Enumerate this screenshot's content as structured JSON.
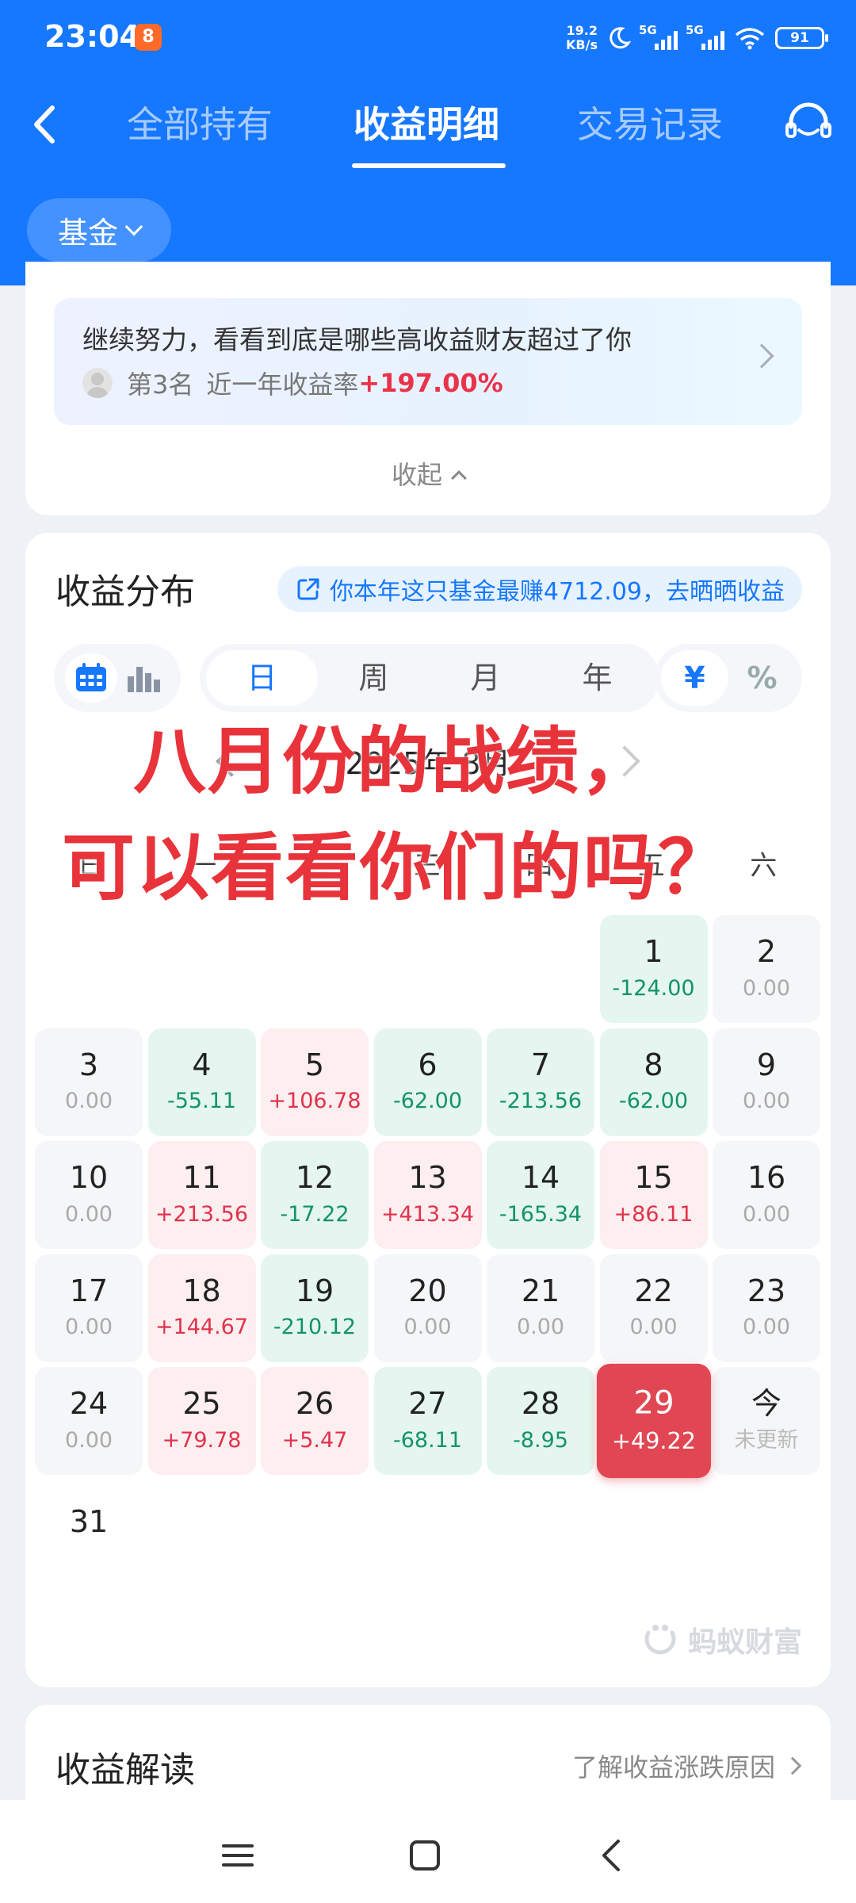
{
  "status_bar": {
    "time": "23:04",
    "app_badge": "8",
    "net_speed_value": "19.2",
    "net_speed_unit": "KB/s",
    "sim1": "5G",
    "sim2": "5G",
    "battery": "91",
    "icons": [
      "moon-icon",
      "signal-icon",
      "wifi-icon",
      "battery-icon"
    ]
  },
  "nav": {
    "tabs": [
      {
        "label": "全部持有",
        "active": false
      },
      {
        "label": "收益明细",
        "active": true
      },
      {
        "label": "交易记录",
        "active": false
      }
    ]
  },
  "filter": {
    "label": "基金"
  },
  "ranking": {
    "title": "继续努力，看看到底是哪些高收益财友超过了你",
    "rank_text": "第3名",
    "rate_label": "近一年收益率",
    "rate_value": "+197.00%",
    "collapse_label": "收起"
  },
  "distribution": {
    "title": "收益分布",
    "share_text": "你本年这只基金最赚4712.09，去晒晒收益",
    "view_modes": [
      "calendar-icon",
      "bar-chart-icon"
    ],
    "periods": [
      "日",
      "周",
      "月",
      "年"
    ],
    "selected_period": "日",
    "units": [
      "¥",
      "%"
    ],
    "selected_unit": "¥",
    "month_label": "2025年 8月",
    "weekdays": [
      "日",
      "一",
      "二",
      "三",
      "四",
      "五",
      "六"
    ],
    "days": [
      {
        "day": "",
        "value": "",
        "kind": "empty"
      },
      {
        "day": "",
        "value": "",
        "kind": "empty"
      },
      {
        "day": "",
        "value": "",
        "kind": "empty"
      },
      {
        "day": "",
        "value": "",
        "kind": "empty"
      },
      {
        "day": "",
        "value": "",
        "kind": "empty"
      },
      {
        "day": "1",
        "value": "-124.00",
        "kind": "loss"
      },
      {
        "day": "2",
        "value": "0.00",
        "kind": "zero"
      },
      {
        "day": "3",
        "value": "0.00",
        "kind": "zero"
      },
      {
        "day": "4",
        "value": "-55.11",
        "kind": "loss"
      },
      {
        "day": "5",
        "value": "+106.78",
        "kind": "gain"
      },
      {
        "day": "6",
        "value": "-62.00",
        "kind": "loss"
      },
      {
        "day": "7",
        "value": "-213.56",
        "kind": "loss"
      },
      {
        "day": "8",
        "value": "-62.00",
        "kind": "loss"
      },
      {
        "day": "9",
        "value": "0.00",
        "kind": "zero"
      },
      {
        "day": "10",
        "value": "0.00",
        "kind": "zero"
      },
      {
        "day": "11",
        "value": "+213.56",
        "kind": "gain"
      },
      {
        "day": "12",
        "value": "-17.22",
        "kind": "loss"
      },
      {
        "day": "13",
        "value": "+413.34",
        "kind": "gain"
      },
      {
        "day": "14",
        "value": "-165.34",
        "kind": "loss"
      },
      {
        "day": "15",
        "value": "+86.11",
        "kind": "gain"
      },
      {
        "day": "16",
        "value": "0.00",
        "kind": "zero"
      },
      {
        "day": "17",
        "value": "0.00",
        "kind": "zero"
      },
      {
        "day": "18",
        "value": "+144.67",
        "kind": "gain"
      },
      {
        "day": "19",
        "value": "-210.12",
        "kind": "loss"
      },
      {
        "day": "20",
        "value": "0.00",
        "kind": "zero"
      },
      {
        "day": "21",
        "value": "0.00",
        "kind": "zero"
      },
      {
        "day": "22",
        "value": "0.00",
        "kind": "zero"
      },
      {
        "day": "23",
        "value": "0.00",
        "kind": "zero"
      },
      {
        "day": "24",
        "value": "0.00",
        "kind": "zero"
      },
      {
        "day": "25",
        "value": "+79.78",
        "kind": "gain"
      },
      {
        "day": "26",
        "value": "+5.47",
        "kind": "gain"
      },
      {
        "day": "27",
        "value": "-68.11",
        "kind": "loss"
      },
      {
        "day": "28",
        "value": "-8.95",
        "kind": "loss"
      },
      {
        "day": "29",
        "value": "+49.22",
        "kind": "sel"
      },
      {
        "day": "今",
        "value": "未更新",
        "kind": "today"
      },
      {
        "day": "31",
        "value": "",
        "kind": "tail"
      }
    ],
    "brand": "蚂蚁财富"
  },
  "overlay": {
    "line1": "八月份的战绩，",
    "line2": "可以看看你们的吗？"
  },
  "interpretation": {
    "title": "收益解读",
    "link": "了解收益涨跌原因"
  },
  "colors": {
    "brand_blue": "#1677ff",
    "gain_red": "#e0334c",
    "loss_green": "#14936a",
    "selected_red": "#e04752",
    "overlay_red": "#e8333b"
  }
}
